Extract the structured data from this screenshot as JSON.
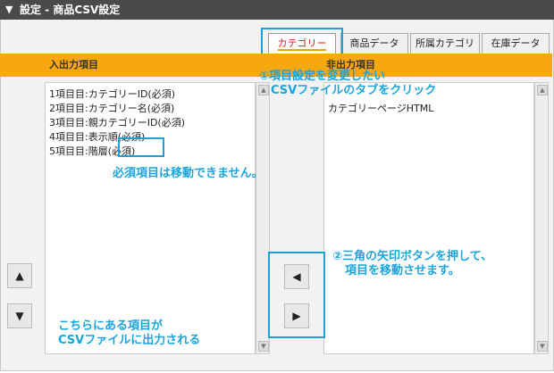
{
  "title": "設定 - 商品CSV設定",
  "tabs": [
    "カテゴリー",
    "商品データ",
    "所属カテゴリ",
    "在庫データ"
  ],
  "headers": {
    "left": "入出力項目",
    "right": "非出力項目"
  },
  "left_items": [
    "1項目目:カテゴリーID(必須)",
    "2項目目:カテゴリー名(必須)",
    "3項目目:親カテゴリーID(必須)",
    "4項目目:表示順(必須)",
    "5項目目:階層(必須)"
  ],
  "right_items": [
    "カテゴリーページHTML"
  ],
  "buttons": {
    "up": "▲",
    "down": "▼",
    "left": "◀",
    "right": "▶"
  },
  "notes": {
    "tab_note_1": "①項目設定を変更したい",
    "tab_note_2": "CSVファイルのタブをクリック",
    "required_note": "必須項目は移動できません。",
    "arrow_note_1": "②三角の矢印ボタンを押して、",
    "arrow_note_2": "項目を移動させます。",
    "output_note_1": "こちらにある項目が",
    "output_note_2": "CSVファイルに出力される"
  },
  "colors": {
    "accent": "#f7a70f",
    "annotation": "#1da0d6",
    "active_tab": "#d81c1c"
  }
}
